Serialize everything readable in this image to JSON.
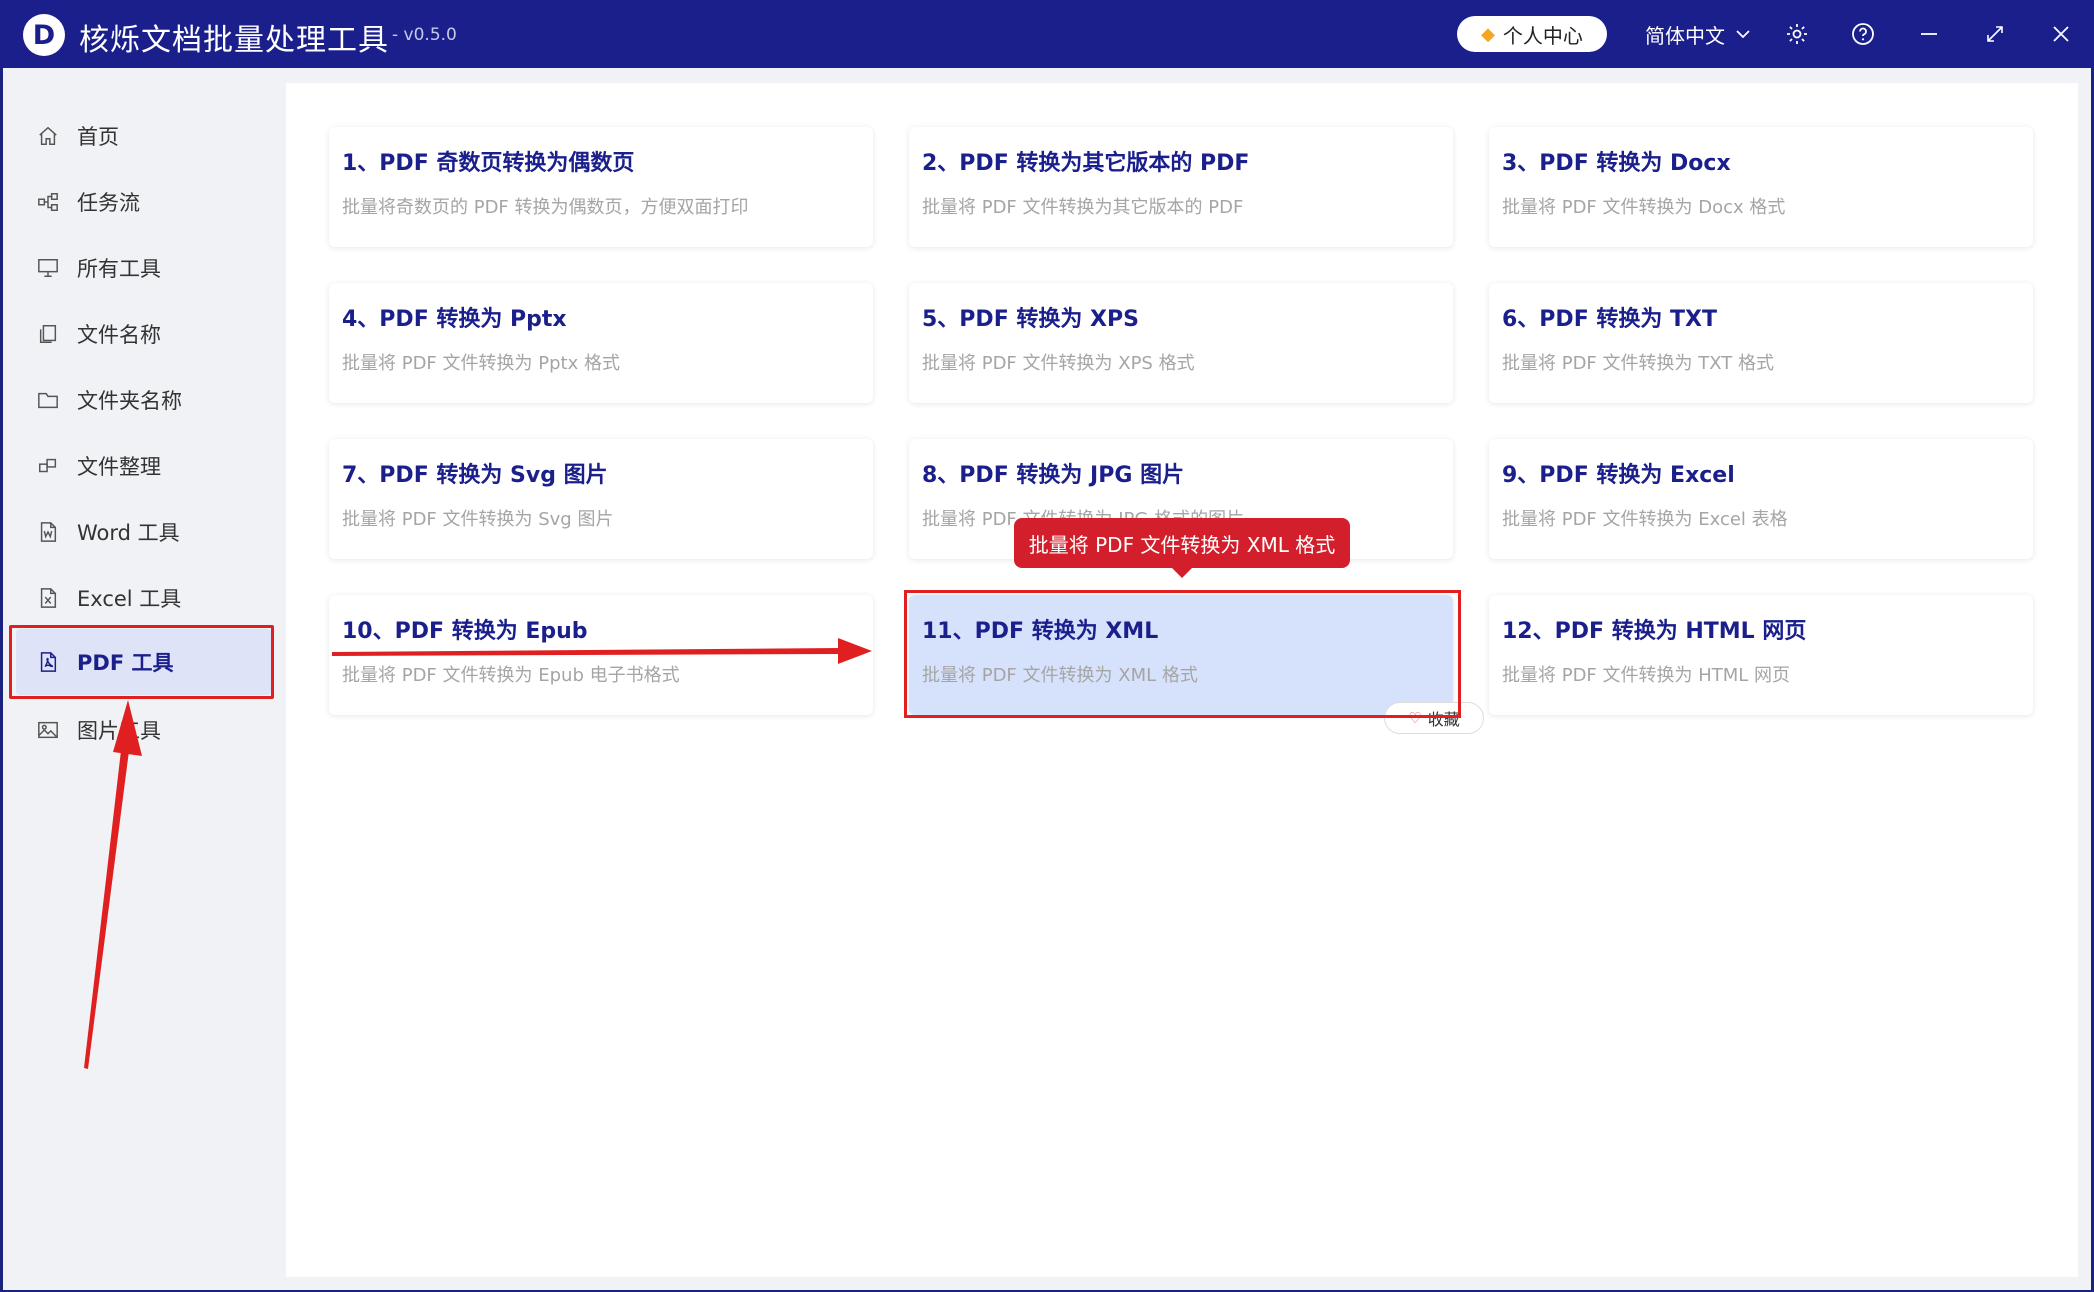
{
  "window": {
    "logo_letter": "D",
    "title": "核烁文档批量处理工具",
    "version": "- v0.5.0",
    "user_center": "个人中心",
    "language": "简体中文"
  },
  "sidebar": {
    "items": [
      {
        "label": "首页",
        "icon": "home-icon"
      },
      {
        "label": "任务流",
        "icon": "flow-icon"
      },
      {
        "label": "所有工具",
        "icon": "monitor-icon"
      },
      {
        "label": "文件名称",
        "icon": "file-copy-icon"
      },
      {
        "label": "文件夹名称",
        "icon": "folder-icon"
      },
      {
        "label": "文件整理",
        "icon": "organize-icon"
      },
      {
        "label": "Word 工具",
        "icon": "word-file-icon"
      },
      {
        "label": "Excel 工具",
        "icon": "excel-file-icon"
      },
      {
        "label": "PDF 工具",
        "icon": "pdf-file-icon",
        "active": true
      },
      {
        "label": "图片工具",
        "icon": "image-icon"
      }
    ]
  },
  "tools": [
    {
      "title": "1、PDF 奇数页转换为偶数页",
      "desc": "批量将奇数页的 PDF 转换为偶数页，方便双面打印"
    },
    {
      "title": "2、PDF 转换为其它版本的 PDF",
      "desc": "批量将 PDF 文件转换为其它版本的 PDF"
    },
    {
      "title": "3、PDF 转换为 Docx",
      "desc": "批量将 PDF 文件转换为 Docx 格式"
    },
    {
      "title": "4、PDF 转换为 Pptx",
      "desc": "批量将 PDF 文件转换为 Pptx 格式"
    },
    {
      "title": "5、PDF 转换为 XPS",
      "desc": "批量将 PDF 文件转换为 XPS 格式"
    },
    {
      "title": "6、PDF 转换为 TXT",
      "desc": "批量将 PDF 文件转换为 TXT 格式"
    },
    {
      "title": "7、PDF 转换为 Svg 图片",
      "desc": "批量将 PDF 文件转换为 Svg 图片"
    },
    {
      "title": "8、PDF 转换为 JPG 图片",
      "desc": "批量将 PDF 文件转换为 JPG 格式的图片"
    },
    {
      "title": "9、PDF 转换为 Excel",
      "desc": "批量将 PDF 文件转换为 Excel 表格"
    },
    {
      "title": "10、PDF 转换为 Epub",
      "desc": "批量将 PDF 文件转换为 Epub 电子书格式"
    },
    {
      "title": "11、PDF 转换为 XML",
      "desc": "批量将 PDF 文件转换为 XML 格式",
      "selected": true
    },
    {
      "title": "12、PDF 转换为 HTML 网页",
      "desc": "批量将 PDF 文件转换为 HTML 网页"
    }
  ],
  "tooltip": "批量将 PDF 文件转换为 XML 格式",
  "favorite_label": "收藏",
  "colors": {
    "titlebar": "#1a1f8c",
    "accent": "#1a1f8c",
    "annotation": "#e02020",
    "selected_card": "#d6e2fb"
  }
}
